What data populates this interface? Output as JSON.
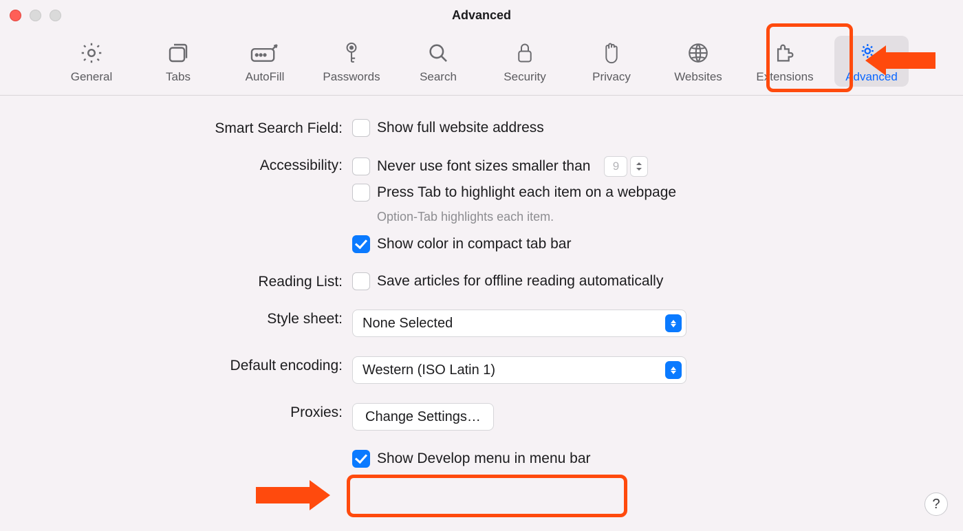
{
  "window": {
    "title": "Advanced"
  },
  "toolbar": {
    "tabs": [
      {
        "name": "general",
        "label": "General"
      },
      {
        "name": "tabs",
        "label": "Tabs"
      },
      {
        "name": "autofill",
        "label": "AutoFill"
      },
      {
        "name": "passwords",
        "label": "Passwords"
      },
      {
        "name": "search",
        "label": "Search"
      },
      {
        "name": "security",
        "label": "Security"
      },
      {
        "name": "privacy",
        "label": "Privacy"
      },
      {
        "name": "websites",
        "label": "Websites"
      },
      {
        "name": "extensions",
        "label": "Extensions"
      },
      {
        "name": "advanced",
        "label": "Advanced"
      }
    ],
    "active": "advanced"
  },
  "sections": {
    "smart_search": {
      "label": "Smart Search Field:",
      "show_full_address": {
        "checked": false,
        "text": "Show full website address"
      }
    },
    "accessibility": {
      "label": "Accessibility:",
      "min_font": {
        "checked": false,
        "text": "Never use font sizes smaller than",
        "value": "9"
      },
      "press_tab": {
        "checked": false,
        "text": "Press Tab to highlight each item on a webpage"
      },
      "hint": "Option-Tab highlights each item.",
      "compact_color": {
        "checked": true,
        "text": "Show color in compact tab bar"
      }
    },
    "reading_list": {
      "label": "Reading List:",
      "offline": {
        "checked": false,
        "text": "Save articles for offline reading automatically"
      }
    },
    "style_sheet": {
      "label": "Style sheet:",
      "value": "None Selected"
    },
    "default_encoding": {
      "label": "Default encoding:",
      "value": "Western (ISO Latin 1)"
    },
    "proxies": {
      "label": "Proxies:",
      "button": "Change Settings…"
    },
    "develop": {
      "checked": true,
      "text": "Show Develop menu in menu bar"
    }
  },
  "help": "?",
  "callouts": {
    "note": "Orange highlight on Advanced tab and on 'Show Develop menu in menu bar' checkbox with arrows."
  }
}
